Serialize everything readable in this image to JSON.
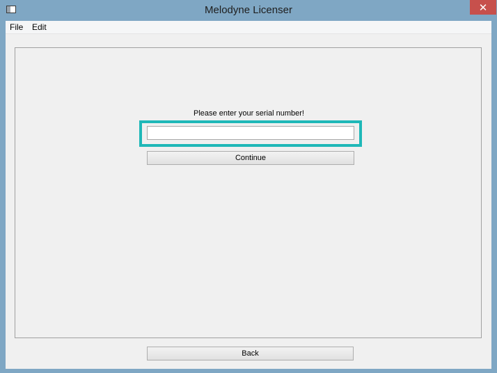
{
  "window": {
    "title": "Melodyne Licenser",
    "close_label": "✕"
  },
  "menubar": {
    "items": [
      "File",
      "Edit"
    ]
  },
  "form": {
    "prompt": "Please enter your serial number!",
    "serial_value": "",
    "continue_label": "Continue"
  },
  "footer": {
    "back_label": "Back"
  },
  "colors": {
    "title_bar": "#7fa7c4",
    "close_button": "#c7504c",
    "highlight": "#1fb8b8",
    "client_bg": "#f0f0f0"
  },
  "icons": {
    "app": "app-window-icon",
    "close": "close-icon"
  }
}
